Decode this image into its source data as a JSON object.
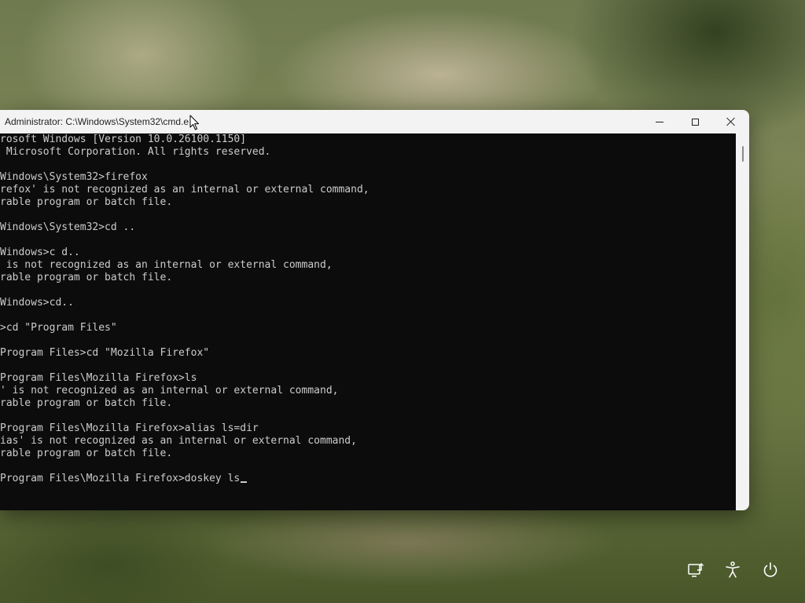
{
  "window": {
    "title": "Administrator: C:\\Windows\\System32\\cmd.e",
    "buttons": {
      "minimize": "minimize-icon",
      "maximize": "maximize-icon",
      "close": "close-icon"
    }
  },
  "console": {
    "lines": [
      "rosoft Windows [Version 10.0.26100.1150]",
      " Microsoft Corporation. All rights reserved.",
      "",
      "Windows\\System32>firefox",
      "refox' is not recognized as an internal or external command,",
      "rable program or batch file.",
      "",
      "Windows\\System32>cd ..",
      "",
      "Windows>c d..",
      " is not recognized as an internal or external command,",
      "rable program or batch file.",
      "",
      "Windows>cd..",
      "",
      ">cd \"Program Files\"",
      "",
      "Program Files>cd \"Mozilla Firefox\"",
      "",
      "Program Files\\Mozilla Firefox>ls",
      "' is not recognized as an internal or external command,",
      "rable program or batch file.",
      "",
      "Program Files\\Mozilla Firefox>alias ls=dir",
      "ias' is not recognized as an internal or external command,",
      "rable program or batch file.",
      "",
      "Program Files\\Mozilla Firefox>doskey ls"
    ],
    "colors": {
      "background": "#0c0c0c",
      "text": "#cccccc"
    }
  },
  "tray": {
    "icons": [
      "network-icon",
      "accessibility-icon",
      "power-icon"
    ]
  }
}
